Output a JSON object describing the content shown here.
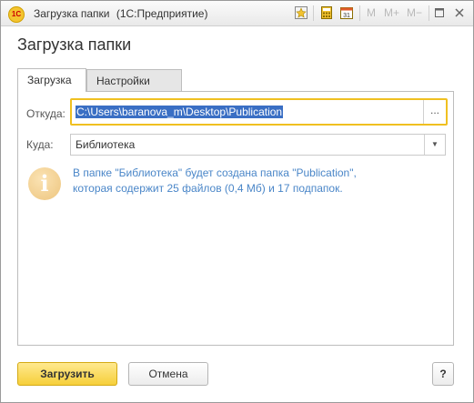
{
  "window": {
    "title": "Загрузка папки",
    "app_name": "(1С:Предприятие)",
    "toolbar": {
      "m_label": "M",
      "m_plus_label": "M+",
      "m_minus_label": "M−"
    }
  },
  "heading": "Загрузка папки",
  "tabs": [
    {
      "label": "Загрузка",
      "active": true
    },
    {
      "label": "Настройки",
      "active": false
    }
  ],
  "form": {
    "from_label": "Откуда:",
    "from_value": "C:\\Users\\baranova_m\\Desktop\\Publication",
    "from_button": "...",
    "to_label": "Куда:",
    "to_value": "Библиотека"
  },
  "info": {
    "line1": "В папке \"Библиотека\" будет создана папка \"Publication\",",
    "line2": "которая содержит 25 файлов (0,4 Мб) и 17 подпапок."
  },
  "buttons": {
    "load": "Загрузить",
    "cancel": "Отмена",
    "help": "?"
  },
  "colors": {
    "accent_yellow": "#f6cf3a",
    "info_blue": "#4a86c8",
    "selection": "#3a6fc4"
  }
}
